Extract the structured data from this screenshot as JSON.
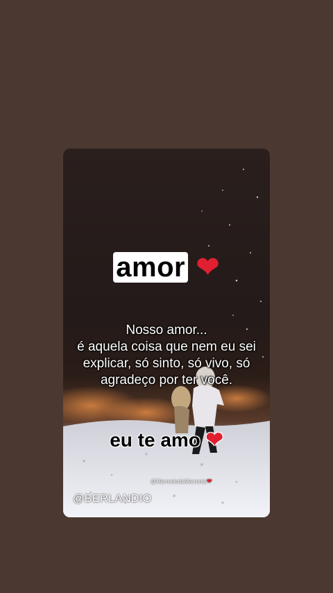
{
  "colors": {
    "background": "#4b3931",
    "heart": "#e02030"
  },
  "card": {
    "title": "amor",
    "title_icon": "heart-icon",
    "poem_lines": [
      "Nosso amor...",
      "é aquela coisa que nem eu sei",
      "explicar, só sinto, só vivo, só",
      "agradeço por ter você."
    ],
    "closing": "eu te amo",
    "closing_icon": "heart-icon",
    "small_handle": "@MarrentodaMarrenta",
    "handle": "@BERLANDIO"
  }
}
